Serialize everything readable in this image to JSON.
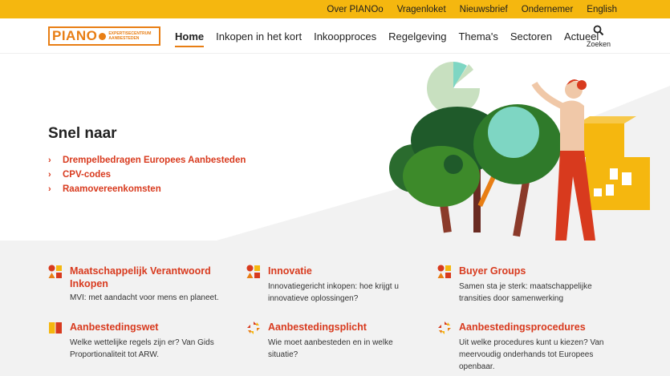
{
  "topbar": {
    "links": [
      "Over PIANOo",
      "Vragenloket",
      "Nieuwsbrief",
      "Ondernemer",
      "English"
    ]
  },
  "logo": {
    "word": "PIANO",
    "sub_line1": "EXPERTISECENTRUM",
    "sub_line2": "AANBESTEDEN"
  },
  "nav": {
    "items": [
      "Home",
      "Inkopen in het kort",
      "Inkoopproces",
      "Regelgeving",
      "Thema's",
      "Sectoren",
      "Actueel"
    ],
    "active": "Home",
    "search_label": "Zoeken"
  },
  "hero": {
    "title": "Snel naar",
    "links": [
      "Drempelbedragen Europees Aanbesteden",
      "CPV-codes",
      "Raamovereenkomsten"
    ]
  },
  "cards": [
    {
      "title": "Maatschappelijk Verantwoord Inkopen",
      "desc": "MVI: met aandacht voor mens en planeet.",
      "icon": "shapes-icon"
    },
    {
      "title": "Innovatie",
      "desc": "Innovatiegericht inkopen: hoe krijgt u innovatieve oplossingen?",
      "icon": "shapes-icon"
    },
    {
      "title": "Buyer Groups",
      "desc": "Samen sta je sterk: maatschappelijke transities door samenwerking",
      "icon": "shapes-icon"
    },
    {
      "title": "Aanbestedingswet",
      "desc": "Welke wettelijke regels zijn er? Van Gids Proportionaliteit tot ARW.",
      "icon": "book-icon"
    },
    {
      "title": "Aanbestedingsplicht",
      "desc": "Wie moet aanbesteden en in welke situatie?",
      "icon": "cycle-icon"
    },
    {
      "title": "Aanbestedingsprocedures",
      "desc": "Uit welke procedures kunt u kiezen? Van meervoudig onderhands tot Europees openbaar.",
      "icon": "cycle-icon"
    }
  ],
  "colors": {
    "topbar": "#f5b70f",
    "accent_red": "#d83a1e",
    "accent_orange": "#e87e14",
    "section_bg": "#f2f2f2"
  }
}
